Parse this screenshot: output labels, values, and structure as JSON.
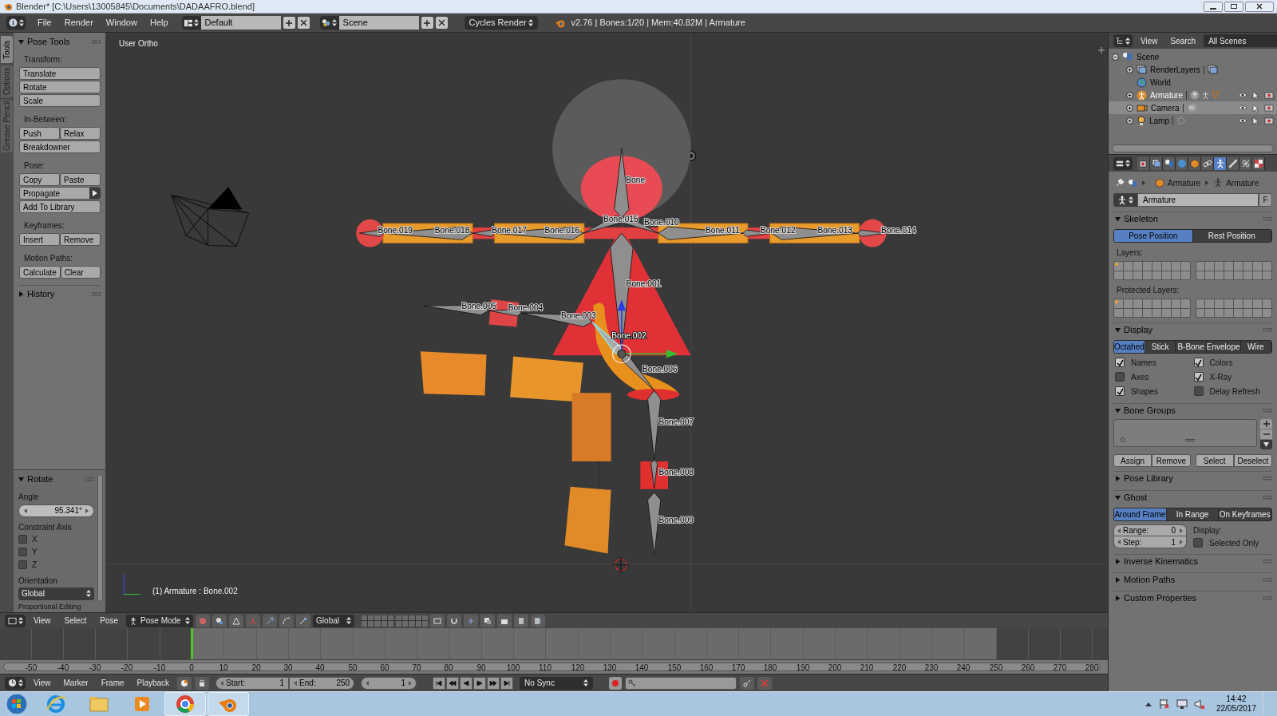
{
  "window": {
    "title": "Blender* [C:\\Users\\13005845\\Documents\\DADAAFRO.blend]"
  },
  "top_header": {
    "menus": [
      "File",
      "Render",
      "Window",
      "Help"
    ],
    "layout": "Default",
    "scene": "Scene",
    "engine": "Cycles Render",
    "stats": "v2.76 | Bones:1/20 | Mem:40.82M | Armature"
  },
  "tool_shelf": {
    "tabs": [
      {
        "label": "Tools",
        "selected": true
      },
      {
        "label": "Options",
        "selected": false
      },
      {
        "label": "Grease Pencil",
        "selected": false
      }
    ],
    "panel_title": "Pose Tools",
    "groups": [
      {
        "label": "Transform:",
        "rows": [
          [
            {
              "label": "Translate",
              "kind": "push"
            }
          ],
          [
            {
              "label": "Rotate",
              "kind": "push"
            }
          ],
          [
            {
              "label": "Scale",
              "kind": "push"
            }
          ]
        ]
      },
      {
        "label": "In-Between:",
        "rows": [
          [
            {
              "label": "Push",
              "kind": "push"
            },
            {
              "label": "Relax",
              "kind": "push"
            }
          ],
          [
            {
              "label": "Breakdowner",
              "kind": "push"
            }
          ]
        ]
      },
      {
        "label": "Pose:",
        "rows": [
          [
            {
              "label": "Copy",
              "kind": "push"
            },
            {
              "label": "Paste",
              "kind": "push"
            }
          ],
          [
            {
              "label": "Propagate",
              "kind": "menu"
            }
          ],
          [
            {
              "label": "Add To Library",
              "kind": "push"
            }
          ]
        ]
      },
      {
        "label": "Keyframes:",
        "rows": [
          [
            {
              "label": "Insert",
              "kind": "push"
            },
            {
              "label": "Remove",
              "kind": "push"
            }
          ]
        ]
      },
      {
        "label": "Motion Paths:",
        "rows": [
          [
            {
              "label": "Calculate",
              "kind": "push"
            },
            {
              "label": "Clear",
              "kind": "push"
            }
          ]
        ]
      }
    ],
    "history": {
      "label": "History",
      "expanded": false
    }
  },
  "operator_panel": {
    "title": "Rotate",
    "expanded": true,
    "angle_label": "Angle",
    "angle": "95.341°",
    "constraint_label": "Constraint Axis",
    "axes": [
      {
        "label": "X",
        "checked": false
      },
      {
        "label": "Y",
        "checked": false
      },
      {
        "label": "Z",
        "checked": false
      }
    ],
    "orientation_label": "Orientation",
    "orientation": "Global",
    "next_label": "Proportional Editing"
  },
  "viewport": {
    "view_name": "User Ortho",
    "status": "(1) Armature : Bone.002",
    "bones": [
      {
        "label": "Bone",
        "selected": false
      },
      {
        "label": "Bone.019",
        "selected": false
      },
      {
        "label": "Bone.018",
        "selected": false
      },
      {
        "label": "Bone.017",
        "selected": false
      },
      {
        "label": "Bone.016",
        "selected": false
      },
      {
        "label": "Bone.015",
        "selected": false
      },
      {
        "label": "Bone.010",
        "selected": false
      },
      {
        "label": "Bone.011",
        "selected": false
      },
      {
        "label": "Bone.012",
        "selected": false
      },
      {
        "label": "Bone.013",
        "selected": false
      },
      {
        "label": "Bone.014",
        "selected": false
      },
      {
        "label": "Bone.001",
        "selected": false
      },
      {
        "label": "Bone.005",
        "selected": false
      },
      {
        "label": "Bone.004",
        "selected": false
      },
      {
        "label": "Bone.003",
        "selected": false
      },
      {
        "label": "Bone.002",
        "selected": true
      },
      {
        "label": "Bone.006",
        "selected": false
      },
      {
        "label": "Bone.007",
        "selected": false
      },
      {
        "label": "Bone.008",
        "selected": false
      },
      {
        "label": "Bone.009",
        "selected": false
      }
    ]
  },
  "viewport_header": {
    "menus": [
      "View",
      "Select",
      "Pose"
    ],
    "mode": "Pose Mode",
    "orientation": "Global"
  },
  "timeline": {
    "ruler": [
      "-50",
      "-40",
      "-30",
      "-20",
      "-10",
      "0",
      "10",
      "20",
      "30",
      "40",
      "50",
      "60",
      "70",
      "80",
      "90",
      "100",
      "110",
      "120",
      "130",
      "140",
      "150",
      "160",
      "170",
      "180",
      "190",
      "200",
      "210",
      "220",
      "230",
      "240",
      "250",
      "260",
      "270",
      "280"
    ]
  },
  "timeline_header": {
    "menus": [
      "View",
      "Marker",
      "Frame",
      "Playback"
    ],
    "start_label": "Start:",
    "start": "1",
    "end_label": "End:",
    "end": "250",
    "frame": "1",
    "sync": "No Sync"
  },
  "outliner": {
    "menus": [
      "View",
      "Search"
    ],
    "filter": "All Scenes",
    "tree": [
      {
        "label": "Scene",
        "kind": "scene",
        "expanded": true,
        "active": false,
        "selected": false,
        "children": [
          {
            "label": "RenderLayers",
            "kind": "render_layers",
            "active": false,
            "selected": false
          },
          {
            "label": "World",
            "kind": "world",
            "active": false,
            "selected": false
          },
          {
            "label": "Armature",
            "kind": "armature",
            "active": true,
            "selected": false
          },
          {
            "label": "Camera",
            "kind": "camera",
            "active": false,
            "selected": true
          },
          {
            "label": "Lamp",
            "kind": "lamp",
            "active": false,
            "selected": false
          }
        ]
      }
    ]
  },
  "properties": {
    "tabs": [
      {
        "kind": "render",
        "selected": false
      },
      {
        "kind": "render_layers",
        "selected": false
      },
      {
        "kind": "scene",
        "selected": false
      },
      {
        "kind": "world",
        "selected": false
      },
      {
        "kind": "object",
        "selected": false
      },
      {
        "kind": "constraints",
        "selected": false
      },
      {
        "kind": "data",
        "selected": true
      },
      {
        "kind": "bone",
        "selected": false
      },
      {
        "kind": "bone_constraints",
        "selected": false
      },
      {
        "kind": "texture",
        "selected": false
      }
    ],
    "breadcrumb": [
      "Armature",
      "Armature"
    ],
    "datablock": "Armature",
    "fake_user": "F",
    "panels": [
      {
        "kind": "skeleton",
        "title": "Skeleton",
        "expanded": true,
        "positions": [
          {
            "label": "Pose Position",
            "selected": true
          },
          {
            "label": "Rest Position",
            "selected": false
          }
        ],
        "layers_label": "Layers:",
        "protected_label": "Protected Layers:"
      },
      {
        "kind": "display",
        "title": "Display",
        "expanded": true,
        "draw_types": [
          {
            "label": "Octahed",
            "selected": true
          },
          {
            "label": "Stick",
            "selected": false
          },
          {
            "label": "B-Bone",
            "selected": false
          },
          {
            "label": "Envelope",
            "selected": false
          },
          {
            "label": "Wire",
            "selected": false
          }
        ],
        "options": [
          {
            "label": "Names",
            "checked": true
          },
          {
            "label": "Colors",
            "checked": true
          },
          {
            "label": "Axes",
            "checked": false
          },
          {
            "label": "X-Ray",
            "checked": true
          },
          {
            "label": "Shapes",
            "checked": true
          },
          {
            "label": "Delay Refresh",
            "checked": false
          }
        ]
      },
      {
        "kind": "bone_groups",
        "title": "Bone Groups",
        "expanded": true,
        "buttons": [
          "Assign",
          "Remove",
          "Select",
          "Deselect"
        ]
      },
      {
        "kind": "plain",
        "title": "Pose Library",
        "expanded": false
      },
      {
        "kind": "ghost",
        "title": "Ghost",
        "expanded": true,
        "types": [
          {
            "label": "Around Frame",
            "selected": true
          },
          {
            "label": "In Range",
            "selected": false
          },
          {
            "label": "On Keyframes",
            "selected": false
          }
        ],
        "range_label": "Range:",
        "range": "0",
        "step_label": "Step:",
        "step": "1",
        "display_label": "Display:",
        "selected_only": {
          "label": "Selected Only",
          "checked": false
        }
      },
      {
        "kind": "plain",
        "title": "Inverse Kinematics",
        "expanded": false
      },
      {
        "kind": "plain",
        "title": "Motion Paths",
        "expanded": false
      },
      {
        "kind": "plain",
        "title": "Custom Properties",
        "expanded": false
      }
    ]
  },
  "taskbar": {
    "apps": [
      {
        "kind": "ie",
        "open": false
      },
      {
        "kind": "folder",
        "open": false
      },
      {
        "kind": "media",
        "open": false
      },
      {
        "kind": "chrome",
        "open": true
      },
      {
        "kind": "blender",
        "open": true
      }
    ],
    "time": "14:42",
    "date": "22/05/2017"
  }
}
